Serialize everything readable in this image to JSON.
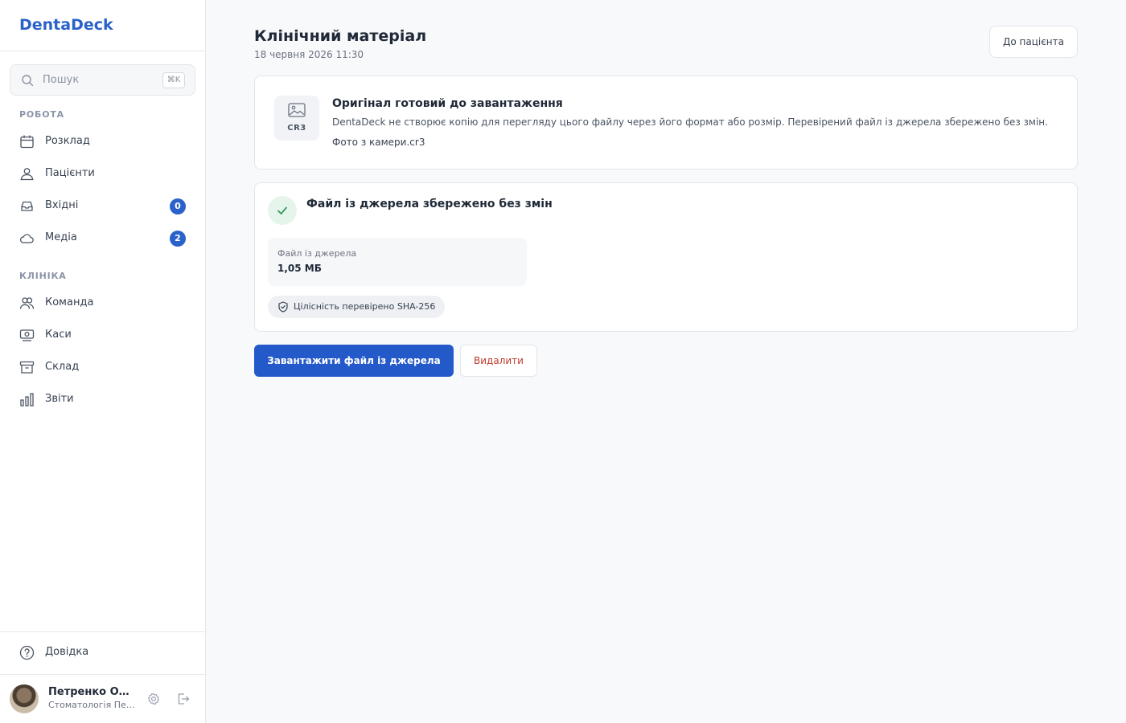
{
  "app": {
    "name": "DentaDeck"
  },
  "sidebar": {
    "search": {
      "placeholder": "Пошук",
      "shortcut": "⌘K"
    },
    "sections": [
      {
        "label": "РОБОТА"
      },
      {
        "label": "КЛІНІКА"
      }
    ],
    "items": [
      {
        "label": "Розклад",
        "icon": "calendar-icon"
      },
      {
        "label": "Пацієнти",
        "icon": "patients-icon"
      },
      {
        "label": "Вхідні",
        "icon": "inbox-icon",
        "badge": "0"
      },
      {
        "label": "Медіа",
        "icon": "cloud-icon",
        "badge": "2"
      },
      {
        "label": "Команда",
        "icon": "team-icon"
      },
      {
        "label": "Каси",
        "icon": "cash-register-icon"
      },
      {
        "label": "Склад",
        "icon": "archive-icon"
      },
      {
        "label": "Звіти",
        "icon": "bar-chart-icon"
      }
    ],
    "help": {
      "label": "Довідка",
      "icon": "help-circle-icon"
    },
    "user": {
      "name": "Петренко Олена",
      "org": "Стоматологія Петренко"
    }
  },
  "header": {
    "title": "Клінічний матеріал",
    "date": "18 червня 2026 11:30",
    "back_button": "До пацієнта"
  },
  "original_card": {
    "file_ext": "CR3",
    "title": "Оригінал готовий до завантаження",
    "description": "DentaDeck не створює копію для перегляду цього файлу через його формат або розмір. Перевірений файл із джерела збережено без змін.",
    "file_name": "Фото з камери.cr3"
  },
  "status_card": {
    "title": "Файл із джерела збережено без змін",
    "meta_label": "Файл із джерела",
    "meta_value": "1,05 МБ",
    "integrity": "Цілісність перевірено SHA-256"
  },
  "actions": {
    "download": "Завантажити файл із джерела",
    "delete": "Видалити"
  },
  "colors": {
    "brand": "#2a62c9",
    "primary_button": "#2459c9",
    "danger_text": "#c0392b",
    "success": "#2f9e5b"
  }
}
